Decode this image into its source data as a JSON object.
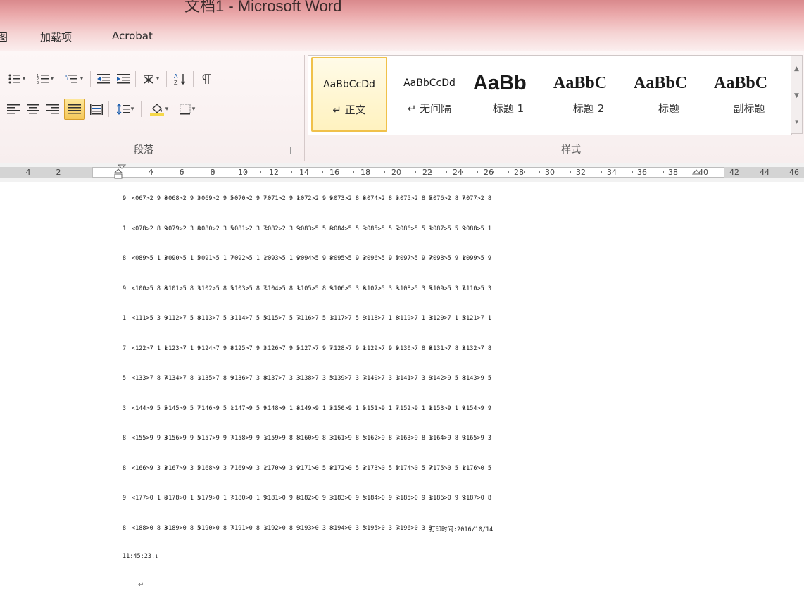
{
  "window": {
    "title": "文档1 - Microsoft Word"
  },
  "tabs": [
    "图",
    "加载项",
    "Acrobat"
  ],
  "ribbon": {
    "paragraph_group_label": "段落",
    "styles_group_label": "样式",
    "styles": [
      {
        "preview": "AaBbCcDd",
        "name": "↵ 正文",
        "selected": true
      },
      {
        "preview": "AaBbCcDd",
        "name": "↵ 无间隔"
      },
      {
        "preview": "AaBb",
        "name": "标题 1"
      },
      {
        "preview": "AaBbC",
        "name": "标题 2"
      },
      {
        "preview": "AaBbC",
        "name": "标题"
      },
      {
        "preview": "AaBbC",
        "name": "副标题"
      }
    ]
  },
  "ruler": {
    "numbers": [
      "4",
      "2",
      "4",
      "6",
      "8",
      "10",
      "12",
      "14",
      "16",
      "18",
      "20",
      "22",
      "24",
      "26",
      "28",
      "30",
      "32",
      "34",
      "36",
      "38",
      "40",
      "42",
      "44",
      "46"
    ]
  },
  "document": {
    "rows": [
      [
        "9",
        "<067>2 9 8",
        "<068>2 9 3",
        "<069>2 9 5",
        "<070>2 9 7",
        "<071>2 9 1",
        "<072>2 9 9",
        "<073>2 8 8",
        "<074>2 8 3",
        "<075>2 8 5",
        "<076>2 8 7",
        "<077>2 8"
      ],
      [
        "1",
        "<078>2 8 9",
        "<079>2 3 8",
        "<080>2 3 5",
        "<081>2 3 7",
        "<082>2 3 9",
        "<083>5 5 8",
        "<084>5 5 3",
        "<085>5 5 7",
        "<086>5 5 1",
        "<087>5 5 9",
        "<088>5 1"
      ],
      [
        "8",
        "<089>5 1 3",
        "<090>5 1 5",
        "<091>5 1 7",
        "<092>5 1 1",
        "<093>5 1 9",
        "<094>5 9 8",
        "<095>5 9 3",
        "<096>5 9 5",
        "<097>5 9 7",
        "<098>5 9 1",
        "<099>5 9"
      ],
      [
        "9",
        "<100>5 8 8",
        "<101>5 8 3",
        "<102>5 8 5",
        "<103>5 8 7",
        "<104>5 8 1",
        "<105>5 8 9",
        "<106>5 3 8",
        "<107>5 3 3",
        "<108>5 3 5",
        "<109>5 3 7",
        "<110>5 3"
      ],
      [
        "1",
        "<111>5 3 9",
        "<112>7 5 8",
        "<113>7 5 3",
        "<114>7 5 5",
        "<115>7 5 7",
        "<116>7 5 1",
        "<117>7 5 9",
        "<118>7 1 8",
        "<119>7 1 3",
        "<120>7 1 5",
        "<121>7 1"
      ],
      [
        "7",
        "<122>7 1 1",
        "<123>7 1 9",
        "<124>7 9 8",
        "<125>7 9 3",
        "<126>7 9 5",
        "<127>7 9 7",
        "<128>7 9 1",
        "<129>7 9 9",
        "<130>7 8 8",
        "<131>7 8 3",
        "<132>7 8"
      ],
      [
        "5",
        "<133>7 8 7",
        "<134>7 8 1",
        "<135>7 8 9",
        "<136>7 3 8",
        "<137>7 3 3",
        "<138>7 3 5",
        "<139>7 3 7",
        "<140>7 3 1",
        "<141>7 3 9",
        "<142>9 5 8",
        "<143>9 5"
      ],
      [
        "3",
        "<144>9 5 5",
        "<145>9 5 7",
        "<146>9 5 1",
        "<147>9 5 9",
        "<148>9 1 8",
        "<149>9 1 3",
        "<150>9 1 5",
        "<151>9 1 7",
        "<152>9 1 1",
        "<153>9 1 9",
        "<154>9 9"
      ],
      [
        "8",
        "<155>9 9 3",
        "<156>9 9 5",
        "<157>9 9 7",
        "<158>9 9 1",
        "<159>9 8 8",
        "<160>9 8 3",
        "<161>9 8 5",
        "<162>9 8 7",
        "<163>9 8 1",
        "<164>9 8 9",
        "<165>9 3"
      ],
      [
        "8",
        "<166>9 3 3",
        "<167>9 3 5",
        "<168>9 3 7",
        "<169>9 3 1",
        "<170>9 3 9",
        "<171>0 5 8",
        "<172>0 5 3",
        "<173>0 5 5",
        "<174>0 5 7",
        "<175>0 5 1",
        "<176>0 5"
      ],
      [
        "9",
        "<177>0 1 8",
        "<178>0 1 5",
        "<179>0 1 7",
        "<180>0 1 9",
        "<181>0 9 8",
        "<182>0 9 3",
        "<183>0 9 5",
        "<184>0 9 7",
        "<185>0 9 1",
        "<186>0 9 9",
        "<187>0 8"
      ],
      [
        "8",
        "<188>0 8 3",
        "<189>0 8 5",
        "<190>0 8 7",
        "<191>0 8 1",
        "<192>0 8 9",
        "<193>0 3 8",
        "<194>0 3 5",
        "<195>0 3 7",
        "<196>0 3 9",
        "打印时间:2016/10/14"
      ]
    ],
    "time_line": "11:45:23.↓"
  },
  "colors": {
    "title_bar": "#d9898c",
    "selected_style_border": "#f0c14a",
    "active_button": "#f5c85a"
  }
}
